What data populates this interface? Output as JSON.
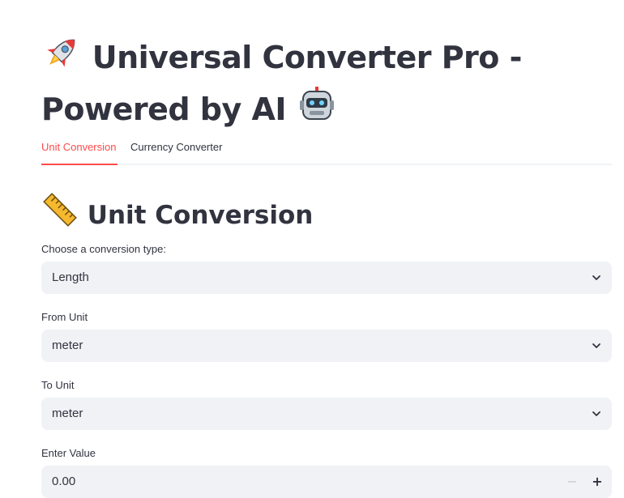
{
  "header": {
    "title_line1": "Universal Converter Pro -",
    "title_line2": "Powered by AI",
    "icons": [
      "rocket-icon",
      "robot-icon"
    ]
  },
  "tabs": [
    {
      "label": "Unit Conversion",
      "active": true
    },
    {
      "label": "Currency Converter",
      "active": false
    }
  ],
  "section": {
    "title": "Unit Conversion",
    "icon": "ruler-icon"
  },
  "form": {
    "conversion_type": {
      "label": "Choose a conversion type:",
      "value": "Length"
    },
    "from_unit": {
      "label": "From Unit",
      "value": "meter"
    },
    "to_unit": {
      "label": "To Unit",
      "value": "meter"
    },
    "value_input": {
      "label": "Enter Value",
      "value": "0.00",
      "minus": "−",
      "plus": "+"
    }
  },
  "colors": {
    "accent": "#ff4b4b",
    "text": "#31333f",
    "input_bg": "#f0f2f6"
  }
}
